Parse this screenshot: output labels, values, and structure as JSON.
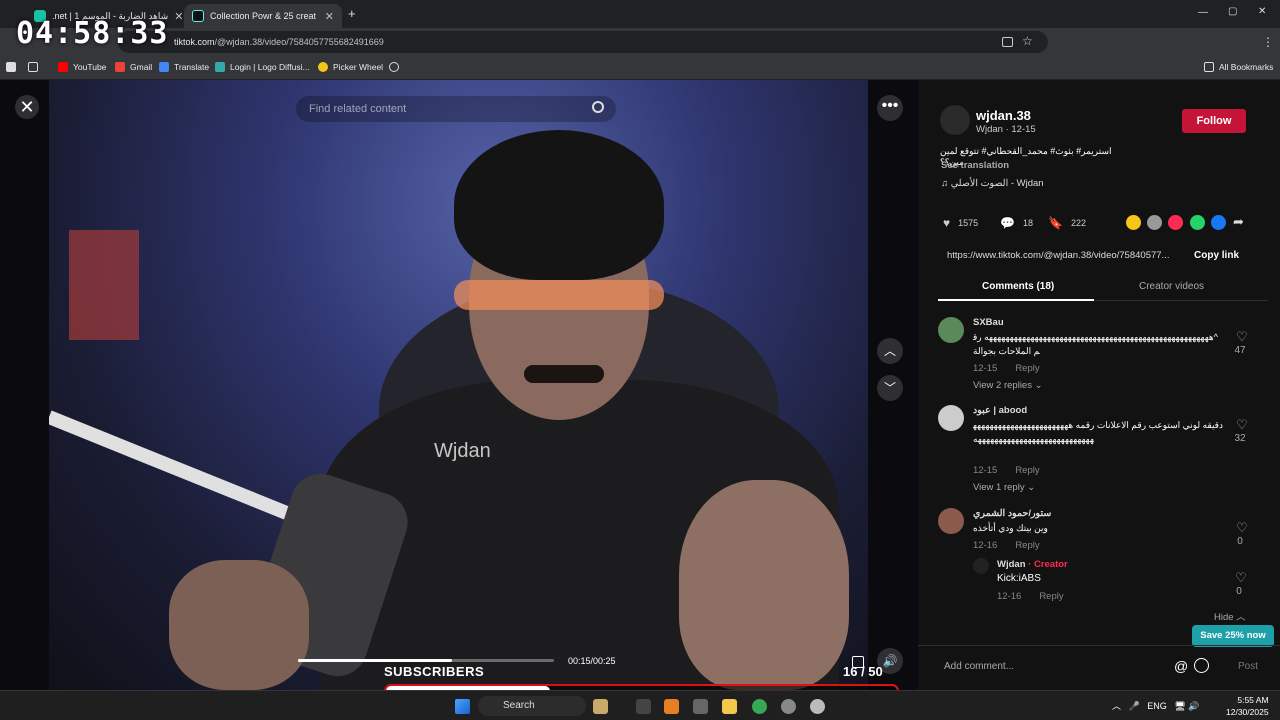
{
  "browser": {
    "tabs": [
      {
        "label": ".net | 1 شاهد الضاربة - الموسم",
        "close": "✕"
      },
      {
        "label": "Collection Powr & 25 creat",
        "close": "✕"
      }
    ],
    "new_tab": "+",
    "url_host": "tiktok.com",
    "url_path": "/@wjdan.38/video/7584057755682491669",
    "bookmarks": [
      "YouTube",
      "Gmail",
      "Translate",
      "Login | Logo Diffusi...",
      "Picker Wheel"
    ],
    "all_bookmarks": "All Bookmarks"
  },
  "timer": "04:58:33",
  "video": {
    "search_placeholder": "Find related content",
    "close": "✕",
    "more": "•••",
    "up": "︿",
    "down": "﹀",
    "watermark": "Wjdan",
    "time": "00:15/00:25",
    "progress": 0.6
  },
  "stream_widget": {
    "label": "SUBSCRIBERS",
    "count": "16 / 50",
    "progress": 0.32
  },
  "panel": {
    "username": "wjdan.38",
    "display": "Wjdan · 12-15",
    "follow": "Follow",
    "caption": "استريمر# بثوث# محمد_القحطاني# تتوقع لمين مين؟؟",
    "see_translation": "See translation",
    "sound": "♫  الصوت الأصلي - Wjdan",
    "likes": "1575",
    "comments_count": "18",
    "saves": "222",
    "link": "https://www.tiktok.com/@wjdan.38/video/75840577...",
    "copy_link": "Copy link",
    "tab_comments": "Comments (18)",
    "tab_creator": "Creator videos",
    "comments": [
      {
        "name": "SXBau",
        "text": "^ههههههههههههههههههههههههههههههههههههههههههههههههههههههه رقم الملاحات بجوالة",
        "date": "12-15",
        "reply": "Reply",
        "likes": "47",
        "view_replies": "View 2 replies ⌄"
      },
      {
        "name": "عبود | abood",
        "text": "دقيقه لوني استوعب رقم الاعلانات رقمه ههههههههههههههههههههههههههههههههههههههههههههههههههههه",
        "date": "12-15",
        "reply": "Reply",
        "likes": "32",
        "view_replies": "View 1 reply ⌄"
      },
      {
        "name": "ستور/حمود الشمري",
        "text": "وين بيتك ودي أتأخذه",
        "date": "12-16",
        "reply": "Reply",
        "likes": "0"
      }
    ],
    "creator_reply": {
      "name": "Wjdan",
      "badge": "· Creator",
      "text": "Kick:iABS",
      "date": "12-16",
      "reply": "Reply",
      "likes": "0"
    },
    "hide": "Hide ︿",
    "save_badge": "Save 25% now",
    "add_comment": "Add comment...",
    "at": "@",
    "post": "Post"
  },
  "taskbar": {
    "search": "Search",
    "lang": "ENG",
    "time": "5:55 AM",
    "date": "12/30/2025"
  },
  "colors": {
    "follow": "#c41437",
    "hashtag": "#8bb4ff",
    "save_badge": "#1ea0a8",
    "widget_border": "#dd1111"
  }
}
